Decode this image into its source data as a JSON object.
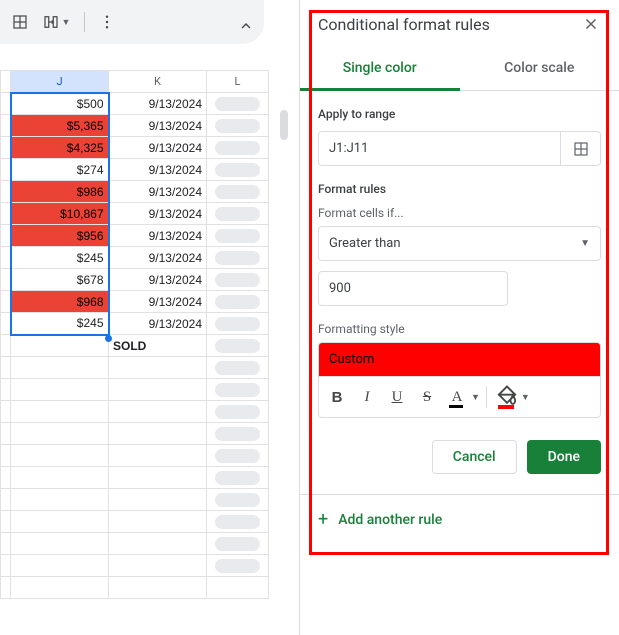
{
  "toolbar": {
    "collapse_tooltip": "Collapse"
  },
  "sheet": {
    "columns": [
      "J",
      "K",
      "L"
    ],
    "selected_column": "J",
    "rows": [
      {
        "j": "$500",
        "k": "9/13/2024",
        "j_red": false
      },
      {
        "j": "$5,365",
        "k": "9/13/2024",
        "j_red": true
      },
      {
        "j": "$4,325",
        "k": "9/13/2024",
        "j_red": true
      },
      {
        "j": "$274",
        "k": "9/13/2024",
        "j_red": false
      },
      {
        "j": "$986",
        "k": "9/13/2024",
        "j_red": true
      },
      {
        "j": "$10,867",
        "k": "9/13/2024",
        "j_red": true
      },
      {
        "j": "$956",
        "k": "9/13/2024",
        "j_red": true
      },
      {
        "j": "$245",
        "k": "9/13/2024",
        "j_red": false
      },
      {
        "j": "$678",
        "k": "9/13/2024",
        "j_red": false
      },
      {
        "j": "$968",
        "k": "9/13/2024",
        "j_red": true
      },
      {
        "j": "$245",
        "k": "9/13/2024",
        "j_red": false
      }
    ],
    "extra_row_k": "SOLD"
  },
  "panel": {
    "title": "Conditional format rules",
    "tabs": {
      "single": "Single color",
      "scale": "Color scale"
    },
    "apply_label": "Apply to range",
    "range_value": "J1:J11",
    "rules_label": "Format rules",
    "cells_if_label": "Format cells if...",
    "condition_selected": "Greater than",
    "value_input": "900",
    "style_label": "Formatting style",
    "style_preview": "Custom",
    "cancel": "Cancel",
    "done": "Done",
    "add_rule": "Add another rule"
  }
}
